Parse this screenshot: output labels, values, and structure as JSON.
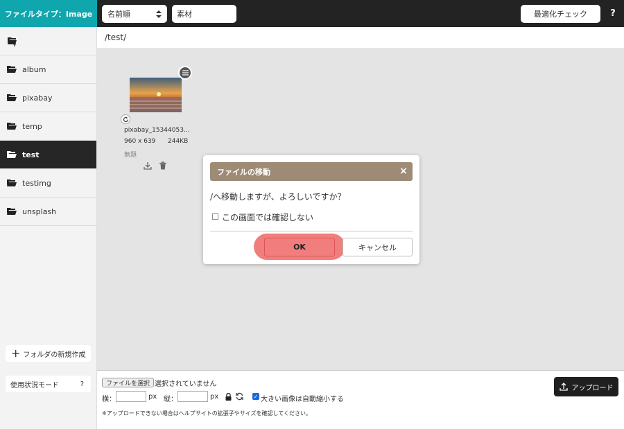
{
  "topbar": {
    "file_type": "ファイルタイプ：Image",
    "sort_select": "名前順",
    "search_value": "素材",
    "optimize_label": "最適化チェック",
    "help_label": "?"
  },
  "sidebar": {
    "items": [
      {
        "label": "album",
        "active": false
      },
      {
        "label": "pixabay",
        "active": false
      },
      {
        "label": "temp",
        "active": false
      },
      {
        "label": "test",
        "active": true
      },
      {
        "label": "testimg",
        "active": false
      },
      {
        "label": "unsplash",
        "active": false
      }
    ],
    "new_folder": "フォルダの新規作成",
    "usage_mode": "使用状況モード",
    "usage_help": "?"
  },
  "path": "/test/",
  "file": {
    "name": "pixabay_15344053…",
    "dimensions": "960 x 639",
    "size": "244KB",
    "caption": "無題"
  },
  "upload": {
    "choose_file": "ファイルを選択",
    "no_file": "選択されていません",
    "width_label": "横：",
    "height_label": "縦：",
    "px1": "px",
    "px2": "px",
    "auto_resize": "大きい画像は自動縮小する",
    "note": "※アップロードできない場合はヘルプサイトの拡張子やサイズを確認してください。",
    "upload_button": "アップロード"
  },
  "dialog": {
    "title": "ファイルの移動",
    "message": "/へ移動しますが、よろしいですか？",
    "checkbox_label": "この画面では確認しない",
    "ok": "OK",
    "cancel": "キャンセル",
    "highlight_color": "#ef6b6b",
    "header_color": "#9d8b76"
  },
  "colors": {
    "accent": "#0fa6ad",
    "topbar": "#232323"
  }
}
